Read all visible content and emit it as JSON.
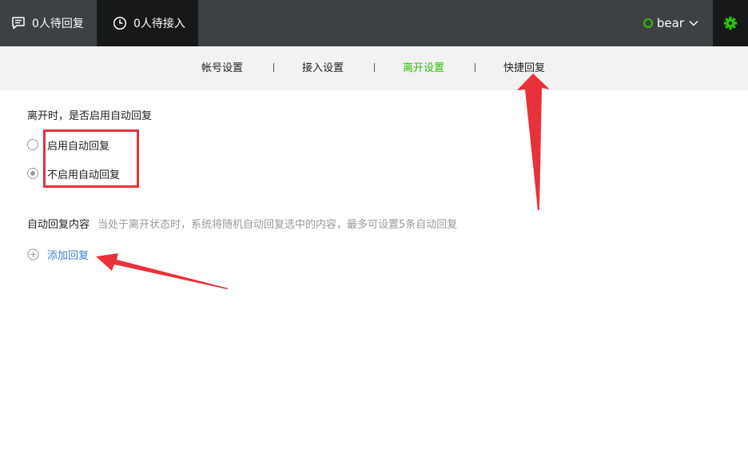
{
  "topbar": {
    "pending_label": "0人待回复",
    "waiting_label": "0人待接入",
    "username": "bear",
    "status_color": "#2dc100"
  },
  "subnav": {
    "tabs": [
      {
        "label": "帐号设置"
      },
      {
        "label": "接入设置"
      },
      {
        "label": "离开设置",
        "active": true
      },
      {
        "label": "快捷回复"
      }
    ],
    "separator": "|"
  },
  "leave": {
    "question": "离开时，是否启用自动回复",
    "options": [
      {
        "label": "启用自动回复",
        "checked": false
      },
      {
        "label": "不启用自动回复",
        "checked": true
      }
    ]
  },
  "auto_reply": {
    "label": "自动回复内容",
    "hint": "当处于离开状态时，系统将随机自动回复选中的内容，最多可设置5条自动回复",
    "add_label": "添加回复"
  },
  "icons": {
    "pending": "chat-bubble-icon",
    "waiting": "clock-icon",
    "dropdown": "chevron-down-icon",
    "settings": "gear-icon",
    "add": "plus-circle-icon"
  },
  "colors": {
    "accent": "#2dc100",
    "link": "#3e7fd0",
    "annotation": "#e8313a",
    "topbar": "#3d4143"
  }
}
